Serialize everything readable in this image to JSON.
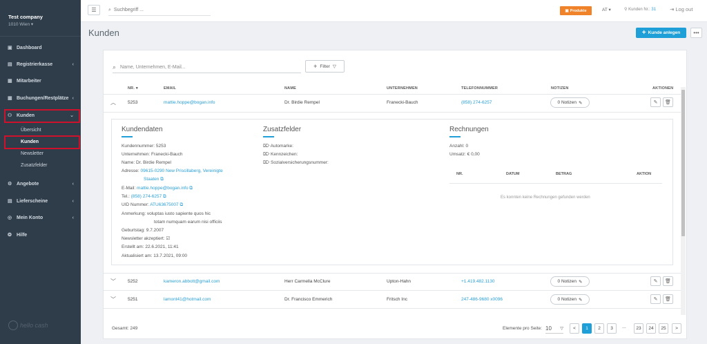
{
  "sidebar": {
    "company_name": "Test company",
    "company_sub": "1010 Wien ▾",
    "items": [
      {
        "label": "Dashboard",
        "icon": "dashboard-icon",
        "glyph": "▣"
      },
      {
        "label": "Registrierkasse",
        "icon": "cash-register-icon",
        "glyph": "▤"
      },
      {
        "label": "Mitarbeiter",
        "icon": "employee-icon",
        "glyph": "▦"
      },
      {
        "label": "Buchungen/Restplätze",
        "icon": "calendar-icon",
        "glyph": "▦"
      },
      {
        "label": "Kunden",
        "icon": "customers-icon",
        "glyph": "⚇"
      },
      {
        "label": "Angebote",
        "icon": "offers-icon",
        "glyph": "⚙"
      },
      {
        "label": "Lieferscheine",
        "icon": "delivery-note-icon",
        "glyph": "▤"
      },
      {
        "label": "Mein Konto",
        "icon": "account-icon",
        "glyph": "◎"
      },
      {
        "label": "Hilfe",
        "icon": "help-icon",
        "glyph": "❂"
      }
    ],
    "sub_items": [
      "Übersicht",
      "Kunden",
      "Newsletter",
      "Zusatzfelder"
    ],
    "logo_text": "hello cash"
  },
  "topbar": {
    "menu_glyph": "☰",
    "search_placeholder": "Suchbegriff ...",
    "products_label": "Produkte",
    "language": "AT",
    "kunden_nr_label": "Kunden Nr.:",
    "kunden_nr_value": "31",
    "logout_label": "Log out"
  },
  "page": {
    "title": "Kunden",
    "new_button": "Kunde anlegen",
    "more_glyph": "•••"
  },
  "filter": {
    "search_placeholder": "Name, Unternehmen, E-Mail...",
    "filter_label": "Filter"
  },
  "table": {
    "headers": [
      "NR.",
      "EMAIL",
      "NAME",
      "UNTERNEHMEN",
      "TELEFONNUMMER",
      "NOTIZEN",
      "AKTIONEN"
    ],
    "sort_glyph": "▾",
    "rows": [
      {
        "nr": "5253",
        "email": "mattie.hoppe@bogan.info",
        "name": "Dr. Birdie Rempel",
        "company": "Franecki-Bauch",
        "phone": "(858) 274-6257",
        "notes": "0 Notizen"
      },
      {
        "nr": "5252",
        "email": "kameron.abbott@gmail.com",
        "name": "Herr Carmella McClure",
        "company": "Upton-Hahn",
        "phone": "+1.419.482.1130",
        "notes": "0 Notizen"
      },
      {
        "nr": "5251",
        "email": "lamont41@hotmail.com",
        "name": "Dr. Francisco Emmerich",
        "company": "Fritsch Inc",
        "phone": "247-486-9680 x0096",
        "notes": "0 Notizen"
      }
    ]
  },
  "detail": {
    "kundendaten_title": "Kundendaten",
    "kundennummer_label": "Kundennummer:",
    "kundennummer": "5253",
    "unternehmen_label": "Unternehmen:",
    "unternehmen": "Franecki-Bauch",
    "name_label": "Name:",
    "name": "Dr. Birdie Rempel",
    "adresse_label": "Adresse:",
    "adresse_1": "09615-0290 New Priscillaberg, Vereinigte",
    "adresse_2": "Staaten",
    "email_label": "E-Mail:",
    "email": "mattie.hoppe@bogan.info",
    "tel_label": "Tel.:",
    "tel": "(858) 274-6257",
    "uid_label": "UID Nummer:",
    "uid": "ATU63675007",
    "anmerkung_label": "Anmerkung:",
    "anmerkung_1": "voluptas iusto sapiente quos hic",
    "anmerkung_2": "totam numquam earum nisi officiis",
    "geburtstag_label": "Geburtstag:",
    "geburtstag": "9.7.2007",
    "newsletter_label": "Newsletter akzeptiert:",
    "erstellt_label": "Erstellt am:",
    "erstellt": "22.6.2021, 11:41",
    "aktualisiert_label": "Aktualisiert am:",
    "aktualisiert": "13.7.2021, 09:00",
    "zusatz_title": "Zusatzfelder",
    "zusatz_fields": [
      "Automarke:",
      "Kennzeichen:",
      "Sozialversicherungsnummer:"
    ],
    "rechnungen_title": "Rechnungen",
    "anzahl_label": "Anzahl:",
    "anzahl": "0",
    "umsatz_label": "Umsatz:",
    "umsatz": "€ 0,00",
    "invoice_headers": [
      "NR.",
      "DATUM",
      "BETRAG",
      "AKTION"
    ],
    "empty_message": "Es konnten keine Rechnungen gefunden werden"
  },
  "footer": {
    "gesamt": "Gesamt: 249",
    "per_page_label": "Elemente pro Seite:",
    "per_page_value": "10",
    "pages": [
      "1",
      "2",
      "3",
      "23",
      "24",
      "25"
    ],
    "dots": "...",
    "prev_glyph": "<",
    "next_glyph": ">"
  },
  "colors": {
    "sidebar_bg": "#2f3d4b",
    "accent": "#1e9fd8",
    "products_orange": "#f0822a",
    "highlight_red": "#d0112b"
  }
}
